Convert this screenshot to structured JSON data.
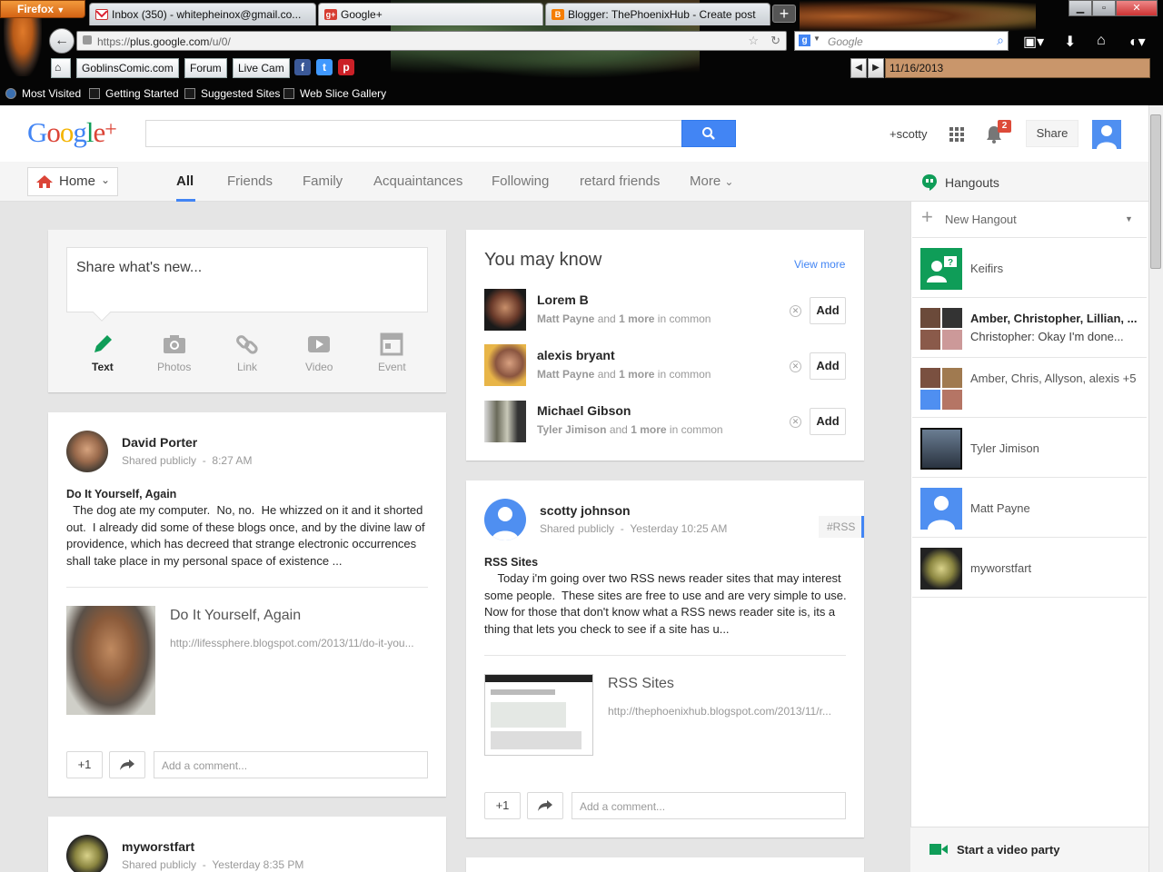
{
  "browser": {
    "menu_label": "Firefox",
    "tabs": [
      {
        "label": "Inbox (350) - whitepheinox@gmail.co...",
        "favicon": "gmail-icon"
      },
      {
        "label": "Google+",
        "favicon": "gplus-icon"
      },
      {
        "label": "Blogger: ThePhoenixHub - Create post",
        "favicon": "blogger-icon"
      }
    ],
    "new_tab": "+",
    "url_prefix": "https://",
    "url_host": "plus.google.com",
    "url_path": "/u/0/",
    "search_placeholder": "Google",
    "toolbar_buttons": [
      "GoblinsComic.com",
      "Forum",
      "Live Cam"
    ],
    "date": "11/16/2013",
    "bookmarks": [
      "Most Visited",
      "Getting Started",
      "Suggested Sites",
      "Web Slice Gallery"
    ]
  },
  "gplus": {
    "logo": "Google+",
    "user_link": "+scotty",
    "notification_count": "2",
    "share_label": "Share",
    "home_label": "Home",
    "nav_tabs": [
      "All",
      "Friends",
      "Family",
      "Acquaintances",
      "Following",
      "retard friends",
      "More"
    ],
    "composer": {
      "placeholder": "Share what's new...",
      "options": [
        "Text",
        "Photos",
        "Link",
        "Video",
        "Event"
      ]
    },
    "you_may_know": {
      "title": "You may know",
      "view_more": "View more",
      "people": [
        {
          "name": "Lorem B",
          "mutual": "Matt Payne",
          "more": "1 more",
          "add": "Add"
        },
        {
          "name": "alexis bryant",
          "mutual": "Matt Payne",
          "more": "1 more",
          "add": "Add"
        },
        {
          "name": "Michael Gibson",
          "mutual": "Tyler Jimison",
          "more": "1 more",
          "add": "Add"
        }
      ],
      "and_word": "and",
      "in_common": "in common"
    },
    "posts": [
      {
        "author": "David Porter",
        "visibility": "Shared publicly",
        "time": "8:27 AM",
        "title": "Do It Yourself, Again",
        "body": "  The dog ate my computer.  No, no.  He whizzed on it and it shorted out.  I already did some of these blogs once, and by the divine law of providence, which has decreed that strange electronic occurrences shall take place in my personal space of existence ...",
        "link_title": "Do It Yourself, Again",
        "link_url": "http://lifessphere.blogspot.com/2013/11/do-it-you...",
        "plus_one": "+1",
        "comment_placeholder": "Add a comment..."
      },
      {
        "author": "scotty johnson",
        "visibility": "Shared publicly",
        "time": "Yesterday 10:25 AM",
        "hashtag": "#RSS",
        "title": "RSS Sites",
        "body": "    Today i'm going over two RSS news reader sites that may interest some people.  These sites are free to use and are very simple to use.  Now for those that don't know what a RSS news reader site is, its a thing that lets you check to see if a site has u...",
        "link_title": "RSS Sites",
        "link_url": "http://thephoenixhub.blogspot.com/2013/11/r...",
        "plus_one": "+1",
        "comment_placeholder": "Add a comment..."
      },
      {
        "author": "myworstfart",
        "visibility": "Shared publicly",
        "time": "Yesterday 8:35 PM"
      }
    ],
    "hangouts": {
      "title": "Hangouts",
      "new_hangout": "New Hangout",
      "items": [
        {
          "name": "Keifirs"
        },
        {
          "name": "Amber, Christopher, Lillian, ...",
          "preview": "Christopher: Okay I'm done..."
        },
        {
          "name": "Amber, Chris, Allyson, alexis +5"
        },
        {
          "name": "Tyler Jimison"
        },
        {
          "name": "Matt Payne"
        },
        {
          "name": "myworstfart"
        }
      ],
      "video_party": "Start a video party"
    },
    "dot": "-"
  },
  "colors": {
    "accent_blue": "#4285f4",
    "hangouts_green": "#0f9d58",
    "notification_red": "#dd4b39"
  }
}
